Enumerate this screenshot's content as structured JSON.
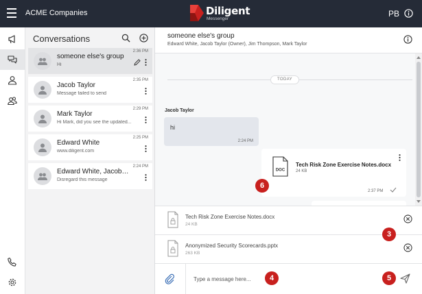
{
  "topbar": {
    "org_name": "ACME Companies",
    "logo_name": "Diligent",
    "logo_sub": "Messenger",
    "user_initials": "PB",
    "brand_red": "#c8201e"
  },
  "rail": {
    "icons": [
      "megaphone-icon",
      "chat-bubbles-icon",
      "person-icon",
      "people-icon",
      "phone-icon",
      "gear-icon"
    ],
    "active": "chat-bubbles-icon"
  },
  "conversations": {
    "title": "Conversations",
    "items": [
      {
        "name": "someone else's group",
        "preview": "Hi",
        "time": "2:36 PM",
        "type": "group",
        "active": true
      },
      {
        "name": "Jacob Taylor",
        "preview": "Message failed to send",
        "time": "2:35 PM",
        "type": "person",
        "active": false
      },
      {
        "name": "Mark Taylor",
        "preview": "Hi Mark, did you see the updated...",
        "time": "2:29 PM",
        "type": "person",
        "active": false
      },
      {
        "name": "Edward White",
        "preview": "www.diligent.com",
        "time": "2:25 PM",
        "type": "person",
        "active": false
      },
      {
        "name": "Edward White, Jacob Taylor",
        "preview": "Disregard this message",
        "time": "2:24 PM",
        "type": "group",
        "active": false
      }
    ]
  },
  "chat": {
    "title": "someone else's group",
    "members": "Edward White, Jacob Taylor (Owner), Jim Thompson, Mark Taylor",
    "date_divider": "TODAY",
    "messages": [
      {
        "sender": "Jacob Taylor",
        "text": "hi",
        "time": "2:24 PM"
      },
      {
        "file_type": "DOC",
        "file_name": "Tech Risk Zone Exercise Notes.docx",
        "file_size": "24 KB",
        "time": "2:37 PM"
      }
    ]
  },
  "attachments": [
    {
      "name": "Tech Risk Zone Exercise Notes.docx",
      "size": "24 KB"
    },
    {
      "name": "Anonymized Security Scorecards.pptx",
      "size": "263 KB"
    }
  ],
  "compose": {
    "placeholder": "Type a message here..."
  },
  "markers": [
    "3",
    "4",
    "5",
    "6"
  ]
}
